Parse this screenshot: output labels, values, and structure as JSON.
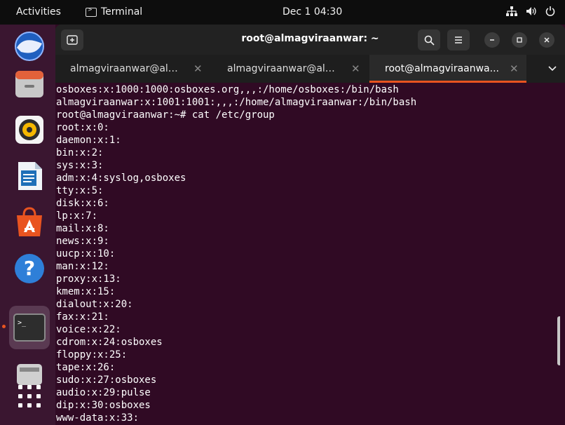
{
  "topbar": {
    "activities": "Activities",
    "app_name": "Terminal",
    "clock": "Dec 1  04:30"
  },
  "window": {
    "title": "root@almagviraanwar: ~"
  },
  "tabs": [
    {
      "label": "almagviraanwar@alm..."
    },
    {
      "label": "almagviraanwar@alm..."
    },
    {
      "label": "root@almagviraanwa..."
    }
  ],
  "terminal_lines": [
    "osboxes:x:1000:1000:osboxes.org,,,:/home/osboxes:/bin/bash",
    "almagviraanwar:x:1001:1001:,,,:/home/almagviraanwar:/bin/bash",
    "root@almagviraanwar:~# cat /etc/group",
    "root:x:0:",
    "daemon:x:1:",
    "bin:x:2:",
    "sys:x:3:",
    "adm:x:4:syslog,osboxes",
    "tty:x:5:",
    "disk:x:6:",
    "lp:x:7:",
    "mail:x:8:",
    "news:x:9:",
    "uucp:x:10:",
    "man:x:12:",
    "proxy:x:13:",
    "kmem:x:15:",
    "dialout:x:20:",
    "fax:x:21:",
    "voice:x:22:",
    "cdrom:x:24:osboxes",
    "floppy:x:25:",
    "tape:x:26:",
    "sudo:x:27:osboxes",
    "audio:x:29:pulse",
    "dip:x:30:osboxes",
    "www-data:x:33:"
  ],
  "colors": {
    "accent": "#e95420",
    "terminal_bg": "#300a24"
  },
  "dock_icons": [
    "thunderbird-icon",
    "files-icon",
    "rhythmbox-icon",
    "writer-icon",
    "software-icon",
    "help-icon",
    "terminal-icon",
    "drive-icon",
    "app-grid-icon"
  ]
}
